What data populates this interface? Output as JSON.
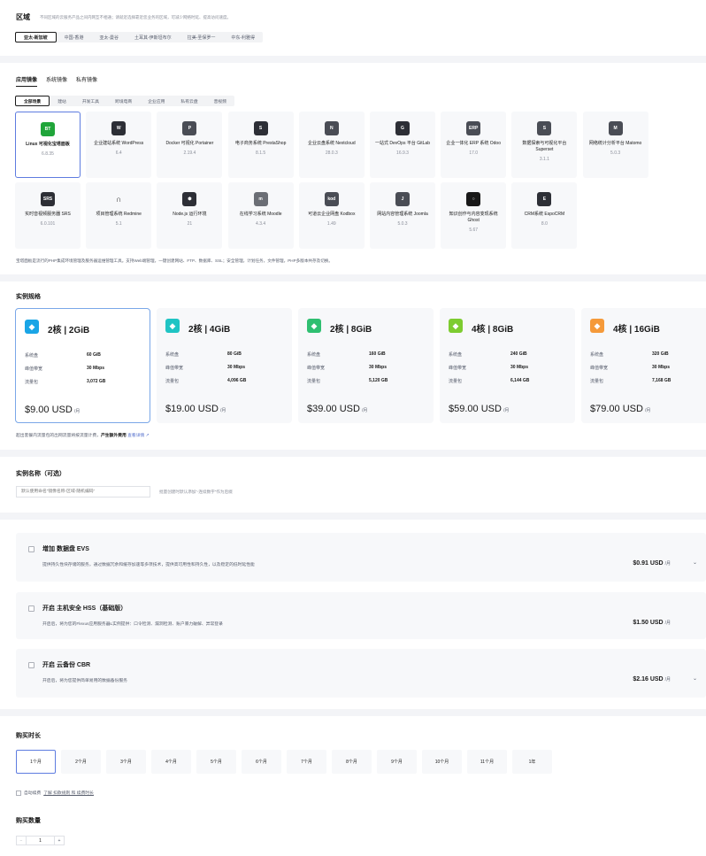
{
  "region": {
    "title": "区域",
    "note": "不同区域的云服务产品之间内网互不相通；请就近选择靠近您业务的区域，可减少网络时延、提高访问速度。",
    "tabs": [
      "亚太-新加坡",
      "中国-香港",
      "亚太-曼谷",
      "土耳其-伊斯坦布尔",
      "拉美-圣保罗一",
      "中东-利雅得"
    ],
    "selected": 0
  },
  "images": {
    "tabs": [
      "应用镜像",
      "系统镜像",
      "私有镜像"
    ],
    "selected_tab": 0,
    "categories": [
      "全部场景",
      "建站",
      "开发工具",
      "跨境电商",
      "企业应用",
      "私有云盘",
      "音视频"
    ],
    "selected_category": 0,
    "apps": [
      {
        "name": "Linux 可视化宝塔面板",
        "version": "6.8.35",
        "icon": "bt-icon",
        "label": "BT",
        "color": "#20a53a"
      },
      {
        "name": "企业建站系统 WordPress",
        "version": "6.4",
        "icon": "wordpress-icon",
        "label": "W",
        "color": "#2d2f36"
      },
      {
        "name": "Docker 可视化 Portainer",
        "version": "2.19.4",
        "icon": "portainer-icon",
        "label": "P",
        "color": "#4a4d55"
      },
      {
        "name": "电子商务系统 PrestaShop",
        "version": "8.1.5",
        "icon": "cart-icon",
        "label": "S",
        "color": "#2d2f36"
      },
      {
        "name": "企业云盘系统 Nextcloud",
        "version": "28.0.3",
        "icon": "cloud-icon",
        "label": "N",
        "color": "#4a4d55"
      },
      {
        "name": "一站式 DevOps 平台 GitLab",
        "version": "16.9.3",
        "icon": "gitlab-icon",
        "label": "G",
        "color": "#2d2f36"
      },
      {
        "name": "企业一体化 ERP 系统 Odoo",
        "version": "17.0",
        "icon": "erp-icon",
        "label": "ERP",
        "color": "#4a4d55"
      },
      {
        "name": "数据探索与可视化平台 Superset",
        "version": "3.1.1",
        "icon": "chart-icon",
        "label": "S",
        "color": "#4a4d55"
      },
      {
        "name": "网络统计分析平台 Matomo",
        "version": "5.0.3",
        "icon": "analytics-icon",
        "label": "M",
        "color": "#4a4d55"
      },
      {
        "name": "实时音视频服务器 SRS",
        "version": "6.0.101",
        "icon": "srs-icon",
        "label": "SRS",
        "color": "#2d2f36"
      },
      {
        "name": "项目管理系统 Redmine",
        "version": "5.1",
        "icon": "redmine-icon",
        "label": "∩",
        "color": "#f7f8fa"
      },
      {
        "name": "Node.js 运行环境",
        "version": "21",
        "icon": "nodejs-icon",
        "label": "⬢",
        "color": "#2d2f36"
      },
      {
        "name": "在线学习系统 Moodle",
        "version": "4.3.4",
        "icon": "moodle-icon",
        "label": "m",
        "color": "#6b6e75"
      },
      {
        "name": "可道云企业网盘 Kodbox",
        "version": "1.49",
        "icon": "kodbox-icon",
        "label": "kod",
        "color": "#4a4d55"
      },
      {
        "name": "网站内容管理系统 Joomla",
        "version": "5.0.3",
        "icon": "joomla-icon",
        "label": "J",
        "color": "#4a4d55"
      },
      {
        "name": "知识创作与内容变现系统 Ghost",
        "version": "5.67",
        "icon": "ghost-icon",
        "label": "○",
        "color": "#191919"
      },
      {
        "name": "CRM系统 EspoCRM",
        "version": "8.0",
        "icon": "espocrm-icon",
        "label": "E",
        "color": "#2d2f36"
      }
    ],
    "selected_app": 0,
    "description": "宝塔面板是流行的PHP集成环境管理及服务器运维管理工具。支持Web端管理，一键创建网站、FTP、数据库、SSL；安全管理，计划任务，文件管理，PHP多版本共存及切换。"
  },
  "specs": {
    "title": "实例规格",
    "labels": {
      "disk": "系统盘",
      "bandwidth": "峰值带宽",
      "traffic": "流量包"
    },
    "unit": "/月",
    "items": [
      {
        "name": "2核 | 2GiB",
        "disk": "60 GiB",
        "bandwidth": "30 Mbps",
        "traffic": "3,072 GB",
        "price": "$9.00 USD",
        "color": "#1aa5e6"
      },
      {
        "name": "2核 | 4GiB",
        "disk": "80 GiB",
        "bandwidth": "30 Mbps",
        "traffic": "4,096 GB",
        "price": "$19.00 USD",
        "color": "#20c4c4"
      },
      {
        "name": "2核 | 8GiB",
        "disk": "160 GiB",
        "bandwidth": "30 Mbps",
        "traffic": "5,120 GB",
        "price": "$39.00 USD",
        "color": "#2fbf71"
      },
      {
        "name": "4核 | 8GiB",
        "disk": "240 GiB",
        "bandwidth": "30 Mbps",
        "traffic": "6,144 GB",
        "price": "$59.00 USD",
        "color": "#7dcc30"
      },
      {
        "name": "4核 | 16GiB",
        "disk": "320 GiB",
        "bandwidth": "30 Mbps",
        "traffic": "7,168 GB",
        "price": "$79.00 USD",
        "color": "#f59a3a"
      }
    ],
    "selected": 0,
    "footnote": "超出套餐内流量包的出网流量将按流量计费，",
    "footnote_bold": "产生额外费用",
    "footnote_link": "查看详情"
  },
  "instance_name": {
    "title": "实例名称（可选）",
    "placeholder": "默认使用命名“镜像名称-区域-随机编码”",
    "hint": "批量创建时默认添加“-连续数字”作为后缀"
  },
  "addons": [
    {
      "title": "增加 数据盘 EVS",
      "desc": "提供持久性块存储的服务，通过数据冗余和缓存加速等多项技术，提供高可用性和持久性，以及稳定的低时延性能",
      "price": "$0.91 USD",
      "unit": "/月",
      "chevron": true
    },
    {
      "title": "开启 主机安全 HSS（基础版）",
      "desc": "开启后，将为您的Flexus应用服务器L实例提供：口令检测、漏洞检测、账户暴力破解、异常登录",
      "price": "$1.50 USD",
      "unit": "/月",
      "chevron": false
    },
    {
      "title": "开启 云备份 CBR",
      "desc": "开启后，将为您提供简单易用的数据备份服务",
      "price": "$2.16 USD",
      "unit": "/月",
      "chevron": true
    }
  ],
  "duration": {
    "title": "购买时长",
    "options": [
      "1个月",
      "2个月",
      "3个月",
      "4个月",
      "5个月",
      "6个月",
      "7个月",
      "8个月",
      "9个月",
      "10个月",
      "11个月",
      "1年"
    ],
    "selected": 0,
    "auto_renew": "自动续费",
    "auto_renew_link": "了解 扣款规则 和 续费时长"
  },
  "quantity": {
    "title": "购买数量",
    "value": "1",
    "minus": "−",
    "plus": "+"
  }
}
